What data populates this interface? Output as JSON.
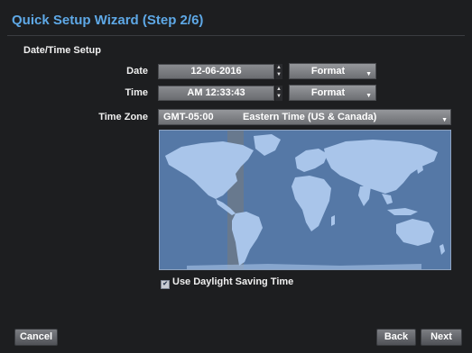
{
  "window": {
    "title": "Quick Setup Wizard (Step 2/6)"
  },
  "section": {
    "title": "Date/Time Setup"
  },
  "date": {
    "label": "Date",
    "value": "12-06-2016",
    "format_label": "Format"
  },
  "time": {
    "label": "Time",
    "value": "AM 12:33:43",
    "format_label": "Format"
  },
  "timezone": {
    "label": "Time Zone",
    "offset": "GMT-05:00",
    "name": "Eastern Time (US & Canada)"
  },
  "dst": {
    "label": "Use Daylight Saving Time",
    "checked": true
  },
  "buttons": {
    "cancel": "Cancel",
    "back": "Back",
    "next": "Next"
  },
  "icons": {
    "spin_up": "spin-up-icon",
    "spin_down": "spin-down-icon",
    "dropdown": "chevron-down-icon",
    "checkbox": "checkmark-icon"
  },
  "colors": {
    "accent": "#5ea8e6",
    "background": "#1d1e20",
    "map_ocean": "#5578a6",
    "map_land": "#a9c5ea",
    "timezone_band": "#6f7a86"
  }
}
